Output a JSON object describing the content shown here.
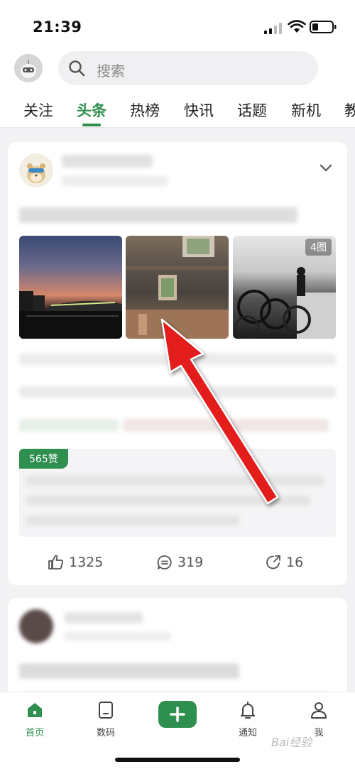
{
  "status_bar": {
    "time": "21:39"
  },
  "search": {
    "placeholder": "搜索"
  },
  "tabs": [
    {
      "label": "关注"
    },
    {
      "label": "头条"
    },
    {
      "label": "热榜"
    },
    {
      "label": "快讯"
    },
    {
      "label": "话题"
    },
    {
      "label": "新机"
    },
    {
      "label": "教"
    }
  ],
  "post": {
    "photo_count": "4图",
    "likes_badge": "565赞",
    "like_count": "1325",
    "comment_count": "319",
    "share_count": "16"
  },
  "bottom_nav": [
    {
      "label": "首页"
    },
    {
      "label": "数码"
    },
    {
      "label": "通知"
    },
    {
      "label": "我"
    }
  ],
  "colors": {
    "accent": "#2f8f4f",
    "arrow": "#e31b1b"
  },
  "watermark": "Bai经验"
}
